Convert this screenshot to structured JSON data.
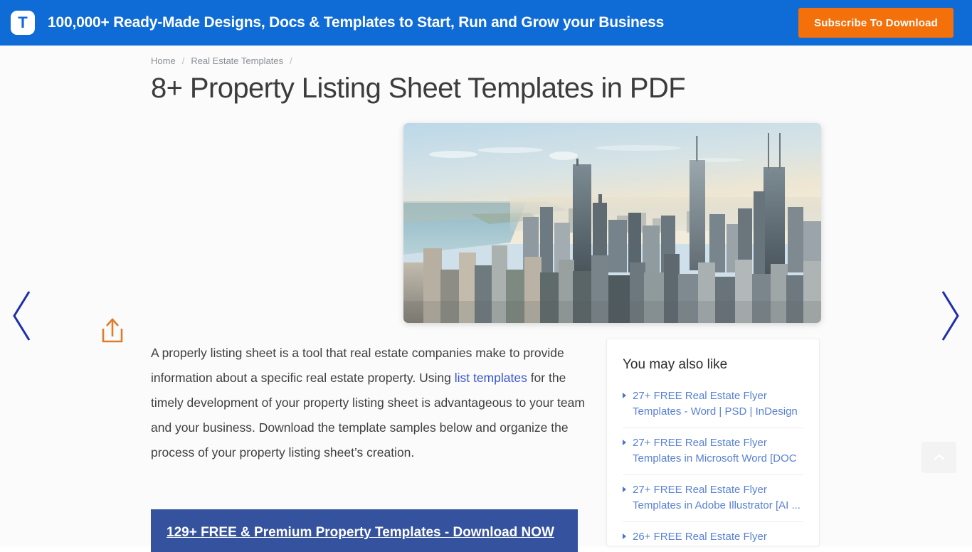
{
  "topbar": {
    "logo_letter": "T",
    "promo_text": "100,000+ Ready-Made Designs, Docs & Templates to Start, Run and Grow your Business",
    "subscribe_label": "Subscribe To Download",
    "bar_color": "#0f6bd6",
    "button_color": "#f4700a"
  },
  "breadcrumb": {
    "home": "Home",
    "sep1": "/",
    "category": "Real Estate Templates",
    "sep2": "/"
  },
  "page_title": "8+ Property Listing Sheet Templates in PDF",
  "carousel": {
    "prev_label": "Previous",
    "next_label": "Next",
    "arrow_color": "#1c2fa8"
  },
  "share": {
    "label": "Share",
    "color": "#e07b2a"
  },
  "hero": {
    "alt": "Aerial view of a city skyline along a lakefront"
  },
  "body": {
    "p1_part1": "A properly listing sheet is a tool that real estate companies make to provide information about a specific real estate property. Using ",
    "p1_link": "list templates",
    "p1_part2": " for the timely development of your property listing sheet is advantageous to your team and your business. Download the template samples below and organize the process of your property listing sheet’s creation."
  },
  "cta": {
    "text": "129+ FREE & Premium Property Templates - Download NOW",
    "background": "#34529e"
  },
  "sidebar": {
    "title": "You may also like",
    "items": [
      {
        "label": "27+ FREE Real Estate Flyer Templates - Word | PSD | InDesign"
      },
      {
        "label": "27+ FREE Real Estate Flyer Templates in Microsoft Word [DOC"
      },
      {
        "label": "27+ FREE Real Estate Flyer Templates in Adobe Illustrator [AI ..."
      },
      {
        "label": "26+ FREE Real Estate Flyer"
      }
    ]
  },
  "scroll_top": {
    "label": "Back to top"
  }
}
